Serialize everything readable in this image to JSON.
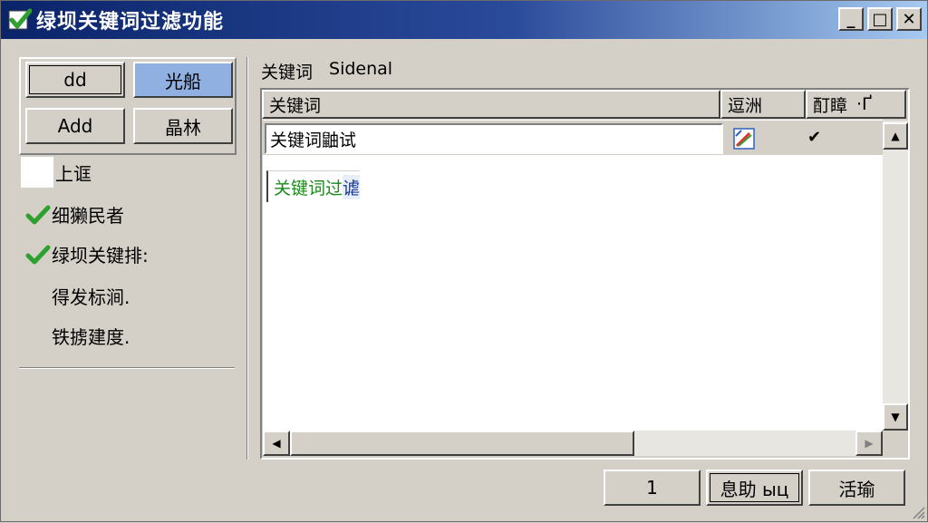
{
  "window": {
    "title": "绿坝关键词过滤功能",
    "buttons": {
      "minimize": "_",
      "maximize": "□",
      "close": "✕"
    }
  },
  "left_panel": {
    "buttons": [
      {
        "label": " dd"
      },
      {
        "label": "光船"
      },
      {
        "label": "Add"
      },
      {
        "label": "晶林"
      }
    ],
    "checklist": [
      {
        "label": "上诓",
        "checked": false
      },
      {
        "label": "细獭民者",
        "checked": true
      },
      {
        "label": "绿坝关键排:",
        "checked": true
      },
      {
        "label": "得发标涧.",
        "checked": false
      },
      {
        "label": "铁掳建度.",
        "checked": false
      }
    ]
  },
  "right_panel": {
    "filter_label": "关键词",
    "filter_value": "Sidenal",
    "columns": [
      "关键词",
      "逗洲",
      "酊瞕"
    ],
    "column_extra": "·Ґ",
    "rows": [
      {
        "keyword": "关键词鼬试",
        "check_mark": "✔"
      }
    ],
    "editing_text": "关键词过",
    "editing_tail": "谑"
  },
  "footer": {
    "buttons": [
      "1",
      "息助 ыц",
      "活瑜"
    ]
  },
  "colors": {
    "title_bar_start": "#0a246a",
    "check_green": "#2ea02e",
    "selected_button": "#8fb0e0",
    "edit_text_green": "#1a8a1a"
  }
}
